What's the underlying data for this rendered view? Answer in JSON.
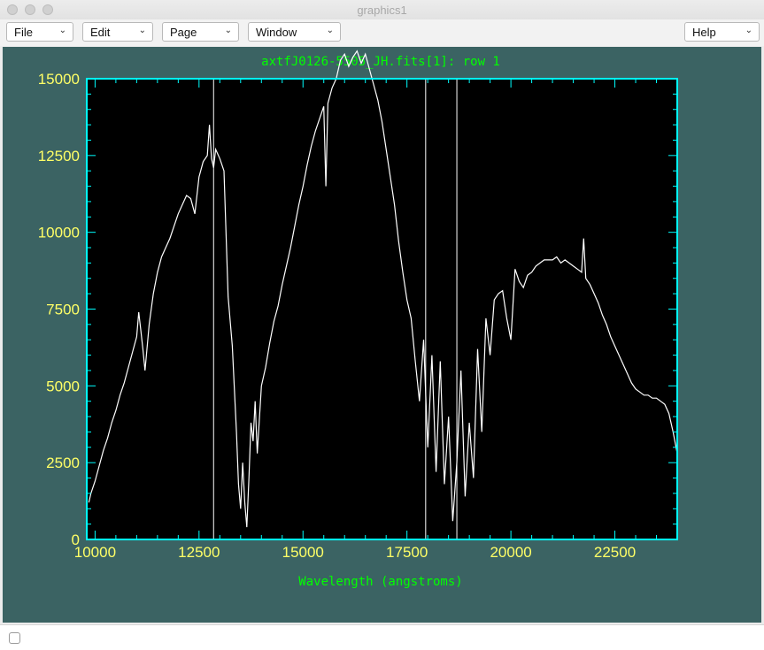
{
  "window": {
    "title": "graphics1"
  },
  "menubar": {
    "file": "File",
    "edit": "Edit",
    "page": "Page",
    "window": "Window",
    "help": "Help"
  },
  "icons": {
    "close": "close-dot-icon",
    "minimize": "minimize-dot-icon",
    "zoom": "zoom-dot-icon",
    "menu_arrow": "chevron-down-icon"
  },
  "colors": {
    "canvas_bg": "#3b6363",
    "plot_bg": "#000000",
    "axes": "#00ffff",
    "tick_labels": "#ffff66",
    "title_text": "#00ff00",
    "spectrum": "#ffffff"
  },
  "chart_data": {
    "type": "line",
    "title": "axtfJ0126-5505_JH.fits[1]: row 1",
    "xlabel": "Wavelength (angstroms)",
    "ylabel": "",
    "xlim": [
      9800,
      24000
    ],
    "ylim": [
      0,
      15000
    ],
    "x_ticks": [
      "10000",
      "12500",
      "15000",
      "17500",
      "20000",
      "22500"
    ],
    "y_ticks": [
      "0",
      "2500",
      "5000",
      "7500",
      "10000",
      "12500",
      "15000"
    ],
    "grid": false,
    "series": [
      {
        "x": [
          9850,
          9900,
          10000,
          10100,
          10200,
          10300,
          10400,
          10500,
          10600,
          10700,
          10800,
          10900,
          11000,
          11050,
          11100,
          11150,
          11200,
          11300,
          11400,
          11500,
          11600,
          11700,
          11800,
          11900,
          12000,
          12100,
          12200,
          12300,
          12400,
          12500,
          12600,
          12700,
          12750,
          12800,
          12850,
          12900,
          13000,
          13100,
          13200,
          13300,
          13400,
          13450,
          13500,
          13550,
          13600,
          13650,
          13700,
          13750,
          13800,
          13850,
          13900,
          14000,
          14100,
          14200,
          14300,
          14400,
          14500,
          14600,
          14700,
          14800,
          14900,
          15000,
          15100,
          15200,
          15300,
          15400,
          15500,
          15550,
          15600,
          15700,
          15800,
          15900,
          16000,
          16100,
          16200,
          16300,
          16400,
          16500,
          16600,
          16700,
          16800,
          16900,
          17000,
          17100,
          17200,
          17300,
          17400,
          17500,
          17600,
          17700,
          17800,
          17900,
          18000,
          18100,
          18200,
          18300,
          18400,
          18500,
          18600,
          18700,
          18800,
          18900,
          19000,
          19100,
          19200,
          19300,
          19400,
          19500,
          19600,
          19700,
          19800,
          19900,
          20000,
          20100,
          20200,
          20300,
          20400,
          20500,
          20600,
          20700,
          20800,
          20900,
          21000,
          21100,
          21200,
          21300,
          21400,
          21500,
          21600,
          21700,
          21750,
          21800,
          21900,
          22000,
          22100,
          22200,
          22300,
          22400,
          22500,
          22600,
          22700,
          22800,
          22900,
          23000,
          23100,
          23200,
          23300,
          23400,
          23500,
          23600,
          23700,
          23800,
          23900,
          24000
        ],
        "y": [
          1200,
          1500,
          1900,
          2400,
          2900,
          3300,
          3800,
          4200,
          4700,
          5100,
          5600,
          6100,
          6600,
          7400,
          6800,
          6200,
          5500,
          7000,
          8000,
          8700,
          9200,
          9500,
          9800,
          10200,
          10600,
          10900,
          11200,
          11100,
          10600,
          11800,
          12300,
          12500,
          13500,
          12400,
          12100,
          12700,
          12400,
          12000,
          7900,
          6300,
          3500,
          1800,
          1000,
          2500,
          1200,
          400,
          2000,
          3800,
          3200,
          4500,
          2800,
          5000,
          5600,
          6400,
          7100,
          7600,
          8300,
          8900,
          9500,
          10200,
          10900,
          11500,
          12200,
          12800,
          13300,
          13700,
          14100,
          11500,
          14200,
          14700,
          15000,
          15600,
          15800,
          15400,
          15700,
          15900,
          15500,
          15800,
          15300,
          14800,
          14300,
          13600,
          12700,
          11800,
          10900,
          9700,
          8700,
          7800,
          7200,
          5800,
          4500,
          6500,
          3000,
          6000,
          2200,
          5800,
          1800,
          4000,
          600,
          2500,
          5500,
          1400,
          3800,
          2000,
          6200,
          3500,
          7200,
          6000,
          7800,
          8000,
          8100,
          7200,
          6500,
          8800,
          8400,
          8200,
          8600,
          8700,
          8900,
          9000,
          9100,
          9100,
          9100,
          9200,
          9000,
          9100,
          9000,
          8900,
          8800,
          8700,
          9800,
          8500,
          8300,
          8000,
          7700,
          7300,
          7000,
          6600,
          6300,
          6000,
          5700,
          5400,
          5100,
          4900,
          4800,
          4700,
          4700,
          4600,
          4600,
          4500,
          4400,
          4100,
          3500,
          2800
        ]
      }
    ],
    "annotations": {
      "vertical_lines_x": [
        12850,
        17950,
        18700
      ]
    }
  }
}
